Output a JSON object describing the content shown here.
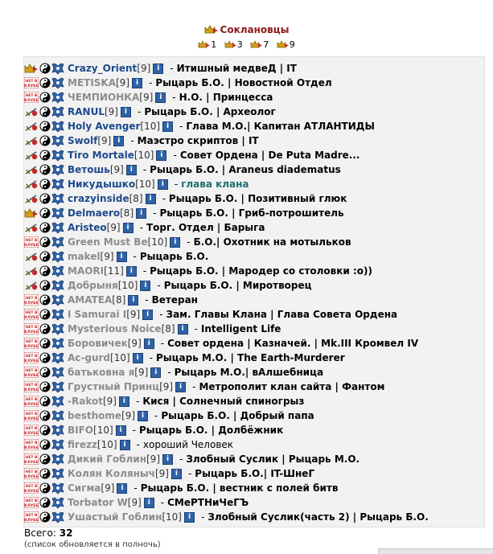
{
  "header": {
    "title": "Соклановцы",
    "pages": [
      "1",
      "3",
      "7",
      "9"
    ]
  },
  "colors": {
    "title": "#8b1a1a",
    "nick_online": "#1d4a8c",
    "nick_offline": "#8c8c8c",
    "teal_status": "#1f6f6f",
    "info_badge": "#2f63a8"
  },
  "members": [
    {
      "nick": "Crazy_Orient",
      "level": "[9]",
      "status": "Итишный медвеД | IT",
      "online": true,
      "icon": "crown"
    },
    {
      "nick": "METISKA",
      "level": "[9]",
      "status": "Рыцарь Б.О. | Новостной Отдел",
      "online": false,
      "icon": "not-in-club"
    },
    {
      "nick": "ЧЕМПИОНКА",
      "level": "[9]",
      "status": "Н.О. | Принцесса",
      "online": false,
      "icon": "not-in-club"
    },
    {
      "nick": "RANUL",
      "level": "[9]",
      "status": "Рыцарь Б.О. | Археолог",
      "online": true,
      "icon": "sword"
    },
    {
      "nick": "Holy Avenger",
      "level": "[10]",
      "status": "Глава М.О.| Капитан АТЛАНТИДЫ",
      "online": true,
      "icon": "sword"
    },
    {
      "nick": "Swolf",
      "level": "[9]",
      "status": "Маэстро скриптов | IT",
      "online": true,
      "icon": "sword"
    },
    {
      "nick": "Tiro Mortale",
      "level": "[10]",
      "status": "Совет Ордена | De Puta Madre...",
      "online": true,
      "icon": "sword"
    },
    {
      "nick": "Ветошь",
      "level": "[9]",
      "status": "Рыцарь Б.О. | Araneus diadematus",
      "online": true,
      "icon": "sword"
    },
    {
      "nick": "Никудышко",
      "level": "[10]",
      "status": "глава клана",
      "online": true,
      "icon": "sword",
      "teal": true
    },
    {
      "nick": "crazyinside",
      "level": "[8]",
      "status": "Рыцарь Б.О. | Позитивный глюк",
      "online": true,
      "icon": "sword"
    },
    {
      "nick": "Delmaero",
      "level": "[8]",
      "status": "Рыцарь Б.О. | Гриб-потрошитель",
      "online": true,
      "icon": "crown"
    },
    {
      "nick": "Aristeo",
      "level": "[9]",
      "status": "Торг. Отдел | Барыга",
      "online": true,
      "icon": "sword"
    },
    {
      "nick": "Green Must Be",
      "level": "[10]",
      "status": "Б.О.| Охотник на мотыльков",
      "online": false,
      "icon": "not-in-club"
    },
    {
      "nick": "makel",
      "level": "[9]",
      "status": "Рыцарь Б.О.",
      "online": false,
      "icon": "sword"
    },
    {
      "nick": "MAORI",
      "level": "[11]",
      "status": "Рыцарь Б.О. | Мародер со столовки :o))",
      "online": false,
      "icon": "sword"
    },
    {
      "nick": "Добрыня",
      "level": "[10]",
      "status": "Рыцарь Б.О. | Миротворец",
      "online": false,
      "icon": "sword"
    },
    {
      "nick": "AMATEA",
      "level": "[8]",
      "status": "Ветеран",
      "online": false,
      "icon": "not-in-club"
    },
    {
      "nick": "I Samurai I",
      "level": "[9]",
      "status": "Зам. Главы Клана | Глава Совета Ордена",
      "online": false,
      "icon": "not-in-club"
    },
    {
      "nick": "Mysterious Noice",
      "level": "[8]",
      "status": "Intelligent Life",
      "online": false,
      "icon": "not-in-club"
    },
    {
      "nick": "Боровичек",
      "level": "[9]",
      "status": "Совет ордена | Казначей. | Mk.III Кромвел IV",
      "online": false,
      "icon": "not-in-club"
    },
    {
      "nick": "Ac-gurd",
      "level": "[10]",
      "status": "Рыцарь М.О. | The Earth-Murderer",
      "online": false,
      "icon": "not-in-club"
    },
    {
      "nick": "батьковна я",
      "level": "[9]",
      "status": "Рыцарь М.О.| вАлшебница",
      "online": false,
      "icon": "not-in-club"
    },
    {
      "nick": "Грустный Принц",
      "level": "[9]",
      "status": "Метрополит клан сайта | Фантом",
      "online": false,
      "icon": "not-in-club"
    },
    {
      "nick": "-Rakot",
      "level": "[9]",
      "status": "Кися | Солнечный спиногрыз",
      "online": false,
      "icon": "not-in-club"
    },
    {
      "nick": "besthome",
      "level": "[9]",
      "status": "Рыцарь Б.О. | Добрый папа",
      "online": false,
      "icon": "not-in-club"
    },
    {
      "nick": "BIFO",
      "level": "[10]",
      "status": "Рыцарь Б.О. | Долбёжник",
      "online": false,
      "icon": "not-in-club"
    },
    {
      "nick": "firezz",
      "level": "[10]",
      "status": "хороший Человек",
      "online": false,
      "icon": "not-in-club",
      "plain": true
    },
    {
      "nick": "Дикий Гоблин",
      "level": "[9]",
      "status": "Злобный Суслик | Рыцарь М.О.",
      "online": false,
      "icon": "not-in-club"
    },
    {
      "nick": "Колян Коляныч",
      "level": "[9]",
      "status": "Рыцарь Б.О.| IT-ШнеГ",
      "online": false,
      "icon": "not-in-club"
    },
    {
      "nick": "Сигма",
      "level": "[9]",
      "status": "Рыцарь Б.О. | вестник с полей битв",
      "online": false,
      "icon": "not-in-club"
    },
    {
      "nick": "Torbator W",
      "level": "[9]",
      "status": "СМеРТНиЧеГЪ",
      "online": false,
      "icon": "not-in-club"
    },
    {
      "nick": "Ушастый Гоблин",
      "level": "[10]",
      "status": "Злобный Суслик(часть 2) | Рыцарь Б.О.",
      "online": false,
      "icon": "not-in-club"
    }
  ],
  "footer": {
    "total_label": "Всего:",
    "total": "32",
    "note": "(список обновляется в полночь)"
  },
  "labels": {
    "not_in_club": "НЕТ В КЛУБЕ",
    "info": "i"
  }
}
